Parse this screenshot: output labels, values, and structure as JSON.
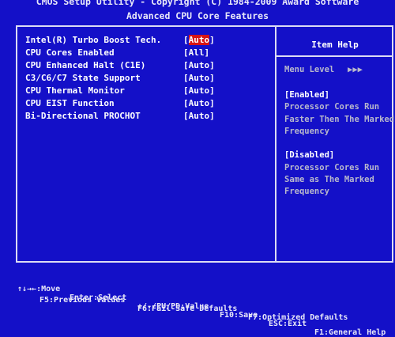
{
  "header": {
    "title_line1": "CMOS Setup Utility - Copyright (C) 1984-2009 Award Software",
    "title_line2": "Advanced CPU Core Features"
  },
  "settings": [
    {
      "label": "Intel(R) Turbo Boost Tech.",
      "value": "Auto",
      "selected": true
    },
    {
      "label": "CPU Cores Enabled",
      "value": "All",
      "selected": false
    },
    {
      "label": "CPU Enhanced Halt (C1E)",
      "value": "Auto",
      "selected": false
    },
    {
      "label": "C3/C6/C7 State Support",
      "value": "Auto",
      "selected": false
    },
    {
      "label": "CPU Thermal Monitor",
      "value": "Auto",
      "selected": false
    },
    {
      "label": "CPU EIST Function",
      "value": "Auto",
      "selected": false
    },
    {
      "label": "Bi-Directional PROCHOT",
      "value": "Auto",
      "selected": false
    }
  ],
  "item_help": {
    "title": "Item Help",
    "menu_level_label": "Menu Level",
    "menu_level_arrows": "▶▶▶",
    "enabled_head": "[Enabled]",
    "enabled_lines": [
      "Processor Cores Run",
      "Faster Then The Marked",
      "Frequency"
    ],
    "disabled_head": "[Disabled]",
    "disabled_lines": [
      "Processor Cores Run",
      "Same as The Marked",
      "Frequency"
    ]
  },
  "footer": {
    "move": "↑↓→←:Move",
    "enter": "Enter:Select",
    "value": "+/-/PU/PD:Value",
    "save": "F10:Save",
    "exit": "ESC:Exit",
    "help": "F1:General Help",
    "prev": "F5:Previous Values",
    "failsafe": "F6:Fail-Safe Defaults",
    "optimized": "F7:Optimized Defaults"
  },
  "colors": {
    "background": "#1410c8",
    "selected_value_bg": "#d81414",
    "text": "#ffffff",
    "help_text": "#b8b8cc"
  }
}
